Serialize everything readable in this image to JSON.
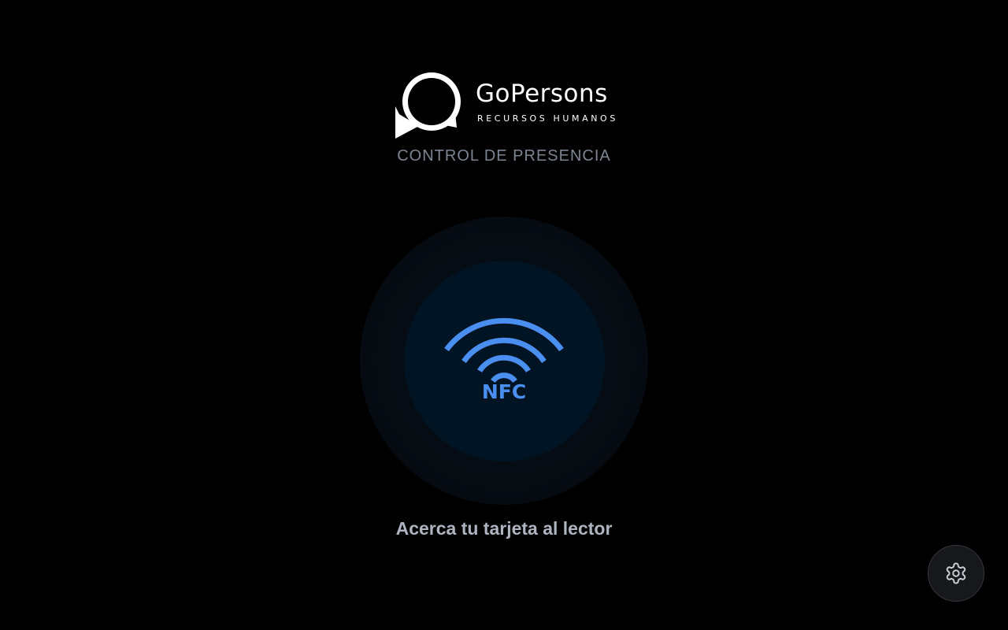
{
  "brand": {
    "name": "GoPersons",
    "tagline": "RECURSOS HUMANOS",
    "logo_icon": "speech-bubble-logo-icon"
  },
  "header": {
    "subtitle": "CONTROL DE PRESENCIA"
  },
  "reader": {
    "icon": "nfc-icon",
    "icon_label": "NFC",
    "prompt": "Acerca tu tarjeta al lector"
  },
  "settings": {
    "icon": "gear-icon"
  },
  "colors": {
    "background": "#000000",
    "accent": "#4a8ff0",
    "reader_fill": "#001424",
    "subtitle": "#7d8592",
    "prompt": "#aeb4bf"
  }
}
